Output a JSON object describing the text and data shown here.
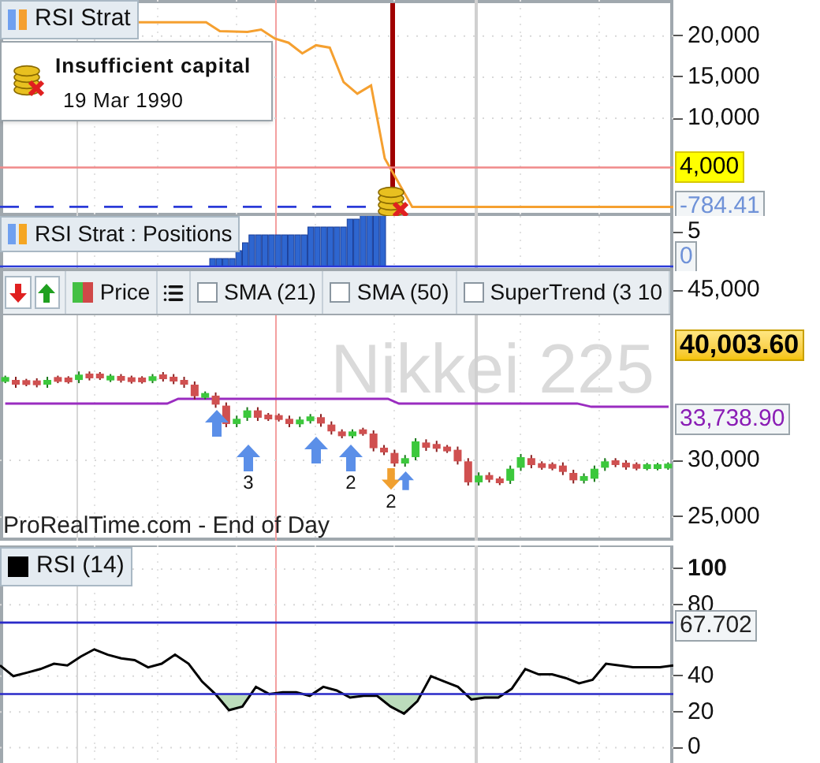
{
  "equity_panel": {
    "tooltip": {
      "title": "Insufficient capital",
      "date": "19 Mar 1990"
    },
    "chart_data": {
      "type": "line",
      "ylim": [
        -1900,
        24400
      ],
      "grid": true,
      "categories": [
        null,
        null,
        null,
        null,
        null,
        null,
        null,
        null,
        null,
        null,
        null,
        null,
        null,
        null,
        null,
        null,
        null,
        null,
        null,
        null,
        null,
        null,
        null,
        null,
        null,
        null,
        null,
        null,
        null,
        null,
        null,
        null,
        null,
        null,
        null,
        null,
        null,
        null,
        null,
        null,
        null,
        null,
        null,
        null,
        null,
        null,
        null,
        null,
        null,
        null
      ],
      "series": [
        {
          "name": "RSI Strat",
          "color": "#f5a030",
          "values": [
            null,
            null,
            null,
            null,
            null,
            null,
            null,
            null,
            null,
            null,
            21700,
            21700,
            21700,
            21700,
            21700,
            21700,
            20600,
            null,
            20500,
            20800,
            19700,
            19200,
            17900,
            18900,
            18600,
            14400,
            13000,
            14000,
            5100,
            null,
            -784.41,
            -784.41,
            -784.41,
            -784.41,
            -784.41,
            -784.41,
            -784.41,
            -784.41,
            -784.41,
            -784.41,
            -784.41,
            -784.41,
            -784.41,
            -784.41,
            -784.41,
            -784.41,
            -784.41,
            -784.41,
            -784.41,
            -784.41
          ]
        }
      ],
      "yticks": [
        {
          "value": 20000,
          "label": "20,000"
        },
        {
          "value": 15000,
          "label": "15,000"
        },
        {
          "value": 10000,
          "label": "10,000"
        }
      ]
    },
    "value_tags": [
      {
        "kind": "highlight",
        "label": "4,000"
      },
      {
        "kind": "plain",
        "label": "-784.41",
        "color": "#6f92d8"
      }
    ]
  },
  "positions_panel": {
    "legend": "RSI Strat : Positions",
    "axis_labels": [
      "5",
      "0"
    ]
  },
  "toolbar": {
    "series": {
      "label": "Price"
    },
    "indicators": [
      {
        "label": "SMA (21)",
        "checked": false
      },
      {
        "label": "SMA (50)",
        "checked": false
      },
      {
        "label": "SuperTrend (3 10",
        "checked": false
      }
    ]
  },
  "price_panel": {
    "watermark": "Nikkei 225",
    "source": "ProRealTime.com - End of Day",
    "axis_labels": [
      "45,000"
    ],
    "value_tags": [
      {
        "kind": "current",
        "label": "40,003.60"
      },
      {
        "kind": "plain",
        "label": "33,738.90",
        "color": "#8a1db5"
      }
    ],
    "signals": [
      {
        "kind": "up"
      },
      {
        "kind": "up",
        "label": "3"
      },
      {
        "kind": "up"
      },
      {
        "kind": "up",
        "label": "2"
      },
      {
        "kind": "down",
        "label": "2"
      },
      {
        "kind": "up"
      }
    ],
    "chart_data": {
      "type": "candlestick",
      "ylim": [
        22916,
        42779
      ],
      "grid": true,
      "categories": [
        null,
        null,
        null,
        null,
        null,
        null,
        null,
        null,
        null,
        null,
        null,
        null,
        null,
        null,
        null,
        null,
        null,
        null,
        null,
        null,
        null,
        null,
        null,
        null,
        null,
        null,
        null,
        null,
        null,
        null,
        null,
        null,
        null,
        null,
        null,
        null,
        null,
        null,
        null,
        null,
        null,
        null,
        null,
        null,
        null,
        null,
        null,
        null,
        null,
        null,
        null,
        null,
        null,
        null,
        null,
        null,
        null,
        null,
        null,
        null,
        null,
        null,
        null,
        null
      ],
      "ohlc": [
        [
          37080,
          37460,
          36800,
          37180
        ],
        [
          37080,
          37360,
          36390,
          36670
        ],
        [
          36900,
          37180,
          36530,
          36810
        ],
        [
          36950,
          37230,
          36430,
          36710
        ],
        [
          36670,
          37360,
          36390,
          37080
        ],
        [
          37180,
          37460,
          36800,
          37080
        ],
        [
          37130,
          37410,
          36760,
          37040
        ],
        [
          37080,
          37830,
          36800,
          37550
        ],
        [
          37550,
          37830,
          37040,
          37320
        ],
        [
          37500,
          37780,
          37080,
          37360
        ],
        [
          37180,
          37600,
          36900,
          37320
        ],
        [
          37320,
          37600,
          36850,
          37130
        ],
        [
          37180,
          37460,
          36760,
          37040
        ],
        [
          37130,
          37410,
          36760,
          37040
        ],
        [
          37080,
          37600,
          36800,
          37320
        ],
        [
          37500,
          37780,
          36940,
          37220
        ],
        [
          37320,
          37600,
          36710,
          36990
        ],
        [
          37080,
          37360,
          36390,
          36670
        ],
        [
          36670,
          36950,
          35370,
          35650
        ],
        [
          35650,
          36070,
          35370,
          35790
        ],
        [
          35700,
          35980,
          34630,
          34910
        ],
        [
          34820,
          35100,
          32920,
          33200
        ],
        [
          33200,
          33940,
          32920,
          33660
        ],
        [
          33750,
          34680,
          33470,
          34400
        ],
        [
          34400,
          34680,
          33470,
          33750
        ],
        [
          33890,
          34170,
          33470,
          33750
        ],
        [
          33840,
          34120,
          33420,
          33700
        ],
        [
          33660,
          33940,
          32920,
          33200
        ],
        [
          33200,
          33850,
          32920,
          33570
        ],
        [
          33520,
          34080,
          33240,
          33800
        ],
        [
          33800,
          34080,
          32960,
          33240
        ],
        [
          33150,
          33430,
          32270,
          32550
        ],
        [
          32450,
          32730,
          31940,
          32220
        ],
        [
          32220,
          32730,
          31940,
          32450
        ],
        [
          32590,
          32870,
          32170,
          32450
        ],
        [
          32360,
          32640,
          30790,
          31070
        ],
        [
          31070,
          31350,
          30460,
          30740
        ],
        [
          30650,
          30930,
          29440,
          29720
        ],
        [
          29720,
          30470,
          29440,
          30190
        ],
        [
          30280,
          31950,
          30000,
          31670
        ],
        [
          31570,
          31850,
          30830,
          31110
        ],
        [
          31440,
          31720,
          30740,
          31020
        ],
        [
          31070,
          31350,
          30650,
          30930
        ],
        [
          30930,
          31210,
          29630,
          29910
        ],
        [
          29910,
          30190,
          27780,
          28060
        ],
        [
          28060,
          28940,
          27780,
          28660
        ],
        [
          28660,
          28940,
          28050,
          28330
        ],
        [
          28290,
          28570,
          27820,
          28100
        ],
        [
          28200,
          29540,
          27920,
          29260
        ],
        [
          29350,
          30560,
          29070,
          30280
        ],
        [
          30190,
          30470,
          29300,
          29580
        ],
        [
          29630,
          29910,
          29170,
          29450
        ],
        [
          29540,
          29820,
          29120,
          29400
        ],
        [
          29540,
          29820,
          28700,
          28980
        ],
        [
          28890,
          29170,
          27960,
          28240
        ],
        [
          28240,
          28850,
          27960,
          28570
        ],
        [
          28380,
          29540,
          28100,
          29260
        ],
        [
          29350,
          30190,
          29070,
          29910
        ],
        [
          29910,
          30190,
          29400,
          29680
        ],
        [
          29720,
          30000,
          29170,
          29450
        ],
        [
          29540,
          29820,
          29120,
          29400
        ],
        [
          29400,
          29770,
          29120,
          29490
        ],
        [
          29400,
          29770,
          29120,
          29490
        ],
        [
          29450,
          29820,
          29170,
          29540
        ]
      ],
      "yticks": [
        {
          "value": 30000,
          "label": "30,000"
        },
        {
          "value": 25000,
          "label": "25,000"
        }
      ]
    }
  },
  "rsi_panel": {
    "value_tags": [
      {
        "kind": "plain",
        "label": "67.702",
        "color": "#222222"
      }
    ],
    "chart_data": {
      "type": "line",
      "ylim": [
        -8.6,
        113.2
      ],
      "grid": true,
      "categories": [
        null,
        null,
        null,
        null,
        null,
        null,
        null,
        null,
        null,
        null,
        null,
        null,
        null,
        null,
        null,
        null,
        null,
        null,
        null,
        null,
        null,
        null,
        null,
        null,
        null,
        null,
        null,
        null,
        null,
        null,
        null,
        null,
        null,
        null,
        null,
        null,
        null,
        null,
        null,
        null,
        null,
        null,
        null,
        null,
        null,
        null,
        null,
        null,
        null,
        null,
        null
      ],
      "series": [
        {
          "name": "RSI (14)",
          "color": "#000000",
          "values": [
            46,
            40,
            42,
            44,
            47,
            46,
            51,
            55,
            52,
            50,
            49,
            45,
            47,
            52,
            47,
            37,
            30,
            21,
            23,
            34,
            30,
            31,
            31,
            29,
            34,
            32,
            28,
            29,
            29,
            23,
            19,
            26,
            40,
            37,
            34,
            27,
            28,
            28,
            33,
            44,
            41,
            41,
            39,
            36,
            38,
            47,
            46,
            45,
            45,
            45,
            46
          ]
        }
      ],
      "yticks": [
        {
          "value": 0,
          "label": "0"
        },
        {
          "value": 20,
          "label": "20"
        },
        {
          "value": 40,
          "label": "40"
        },
        {
          "value": 80,
          "label": "80"
        },
        {
          "value": 100,
          "label": "100"
        }
      ]
    }
  }
}
